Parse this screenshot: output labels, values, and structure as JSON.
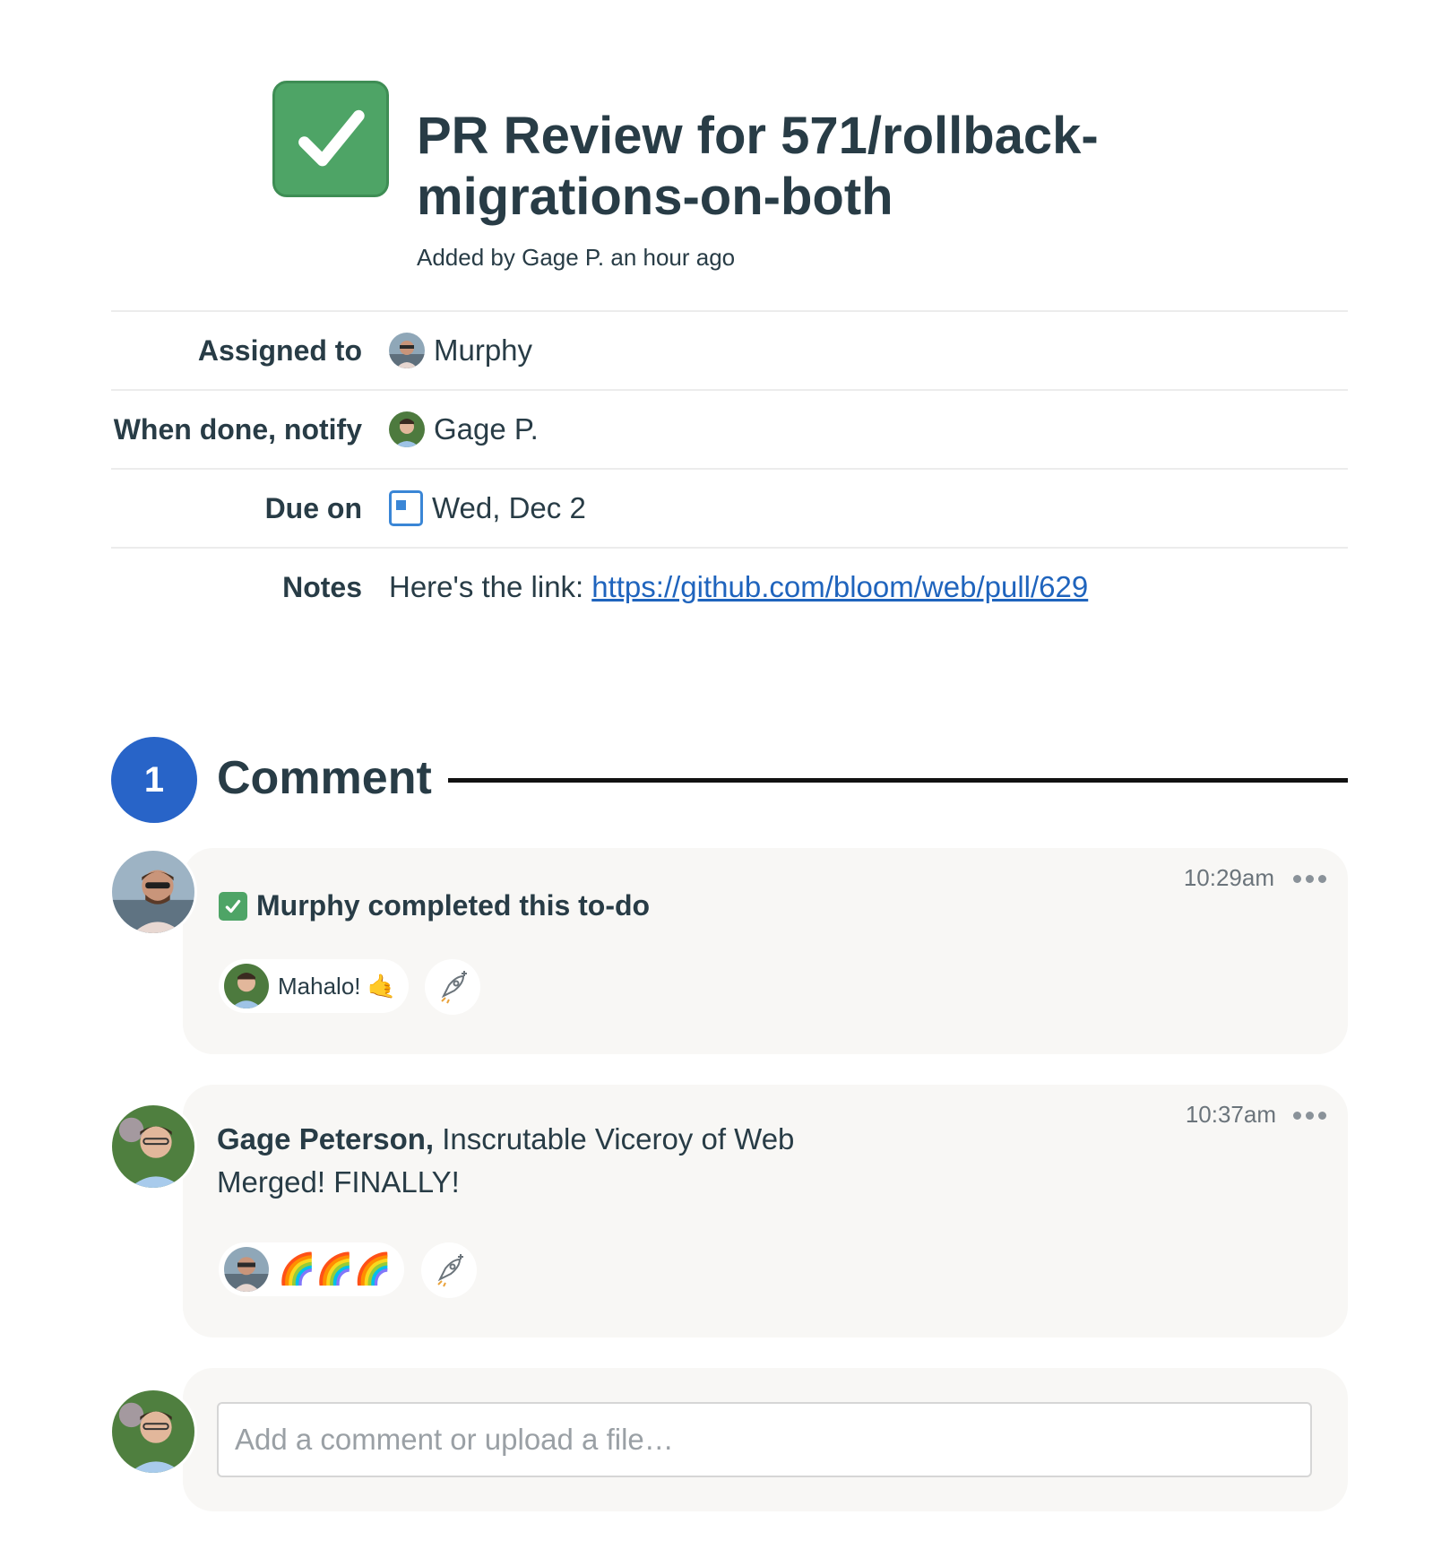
{
  "todo": {
    "title": "PR Review for 571/rollback-migrations-on-both",
    "added_by": "Added by Gage P. an hour ago",
    "completed": true
  },
  "details": {
    "assigned_label": "Assigned to",
    "assigned_value": "Murphy",
    "notify_label": "When done, notify",
    "notify_value": "Gage P.",
    "due_label": "Due on",
    "due_value": "Wed, Dec 2",
    "notes_label": "Notes",
    "notes_prefix": "Here's the link:",
    "notes_link": "https://github.com/bloom/web/pull/629"
  },
  "comments_header": {
    "count": "1",
    "label": "Comment"
  },
  "events": [
    {
      "text": "Murphy completed this to-do",
      "time": "10:29am",
      "boost_text": "Mahalo! 🤙"
    }
  ],
  "comments": [
    {
      "author": "Gage Peterson,",
      "role": "Inscrutable Viceroy of Web",
      "body": "Merged! FINALLY!",
      "time": "10:37am",
      "boost_text": "🌈🌈🌈"
    }
  ],
  "composer": {
    "placeholder": "Add a comment or upload a file…"
  },
  "colors": {
    "check_green": "#4ea466",
    "accent_blue": "#2864c8",
    "link_blue": "#1f64bd",
    "card_bg": "#f8f7f5"
  },
  "icons": {
    "todo_status": "checkmark-icon",
    "calendar": "calendar-icon",
    "more": "ellipsis-icon",
    "boost": "rocket-boost-icon"
  }
}
